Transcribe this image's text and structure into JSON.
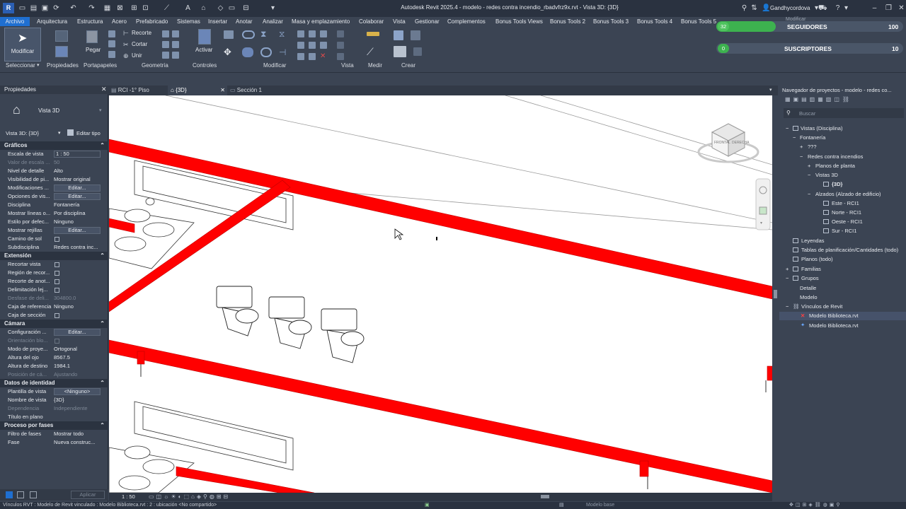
{
  "titlebar": {
    "title": "Autodesk Revit 2025.4 - modelo - redes contra incendio_rbadvfrz9x.rvt - Vista 3D: {3D}",
    "user": "Gandhycordova",
    "app_logo": "R"
  },
  "menu": {
    "items": [
      "Archivo",
      "Arquitectura",
      "Estructura",
      "Acero",
      "Prefabricado",
      "Sistemas",
      "Insertar",
      "Anotar",
      "Analizar",
      "Masa y emplazamiento",
      "Colaborar",
      "Vista",
      "Gestionar",
      "Complementos",
      "Bonus Tools Views",
      "Bonus Tools 2",
      "Bonus Tools 3",
      "Bonus Tools 4",
      "Bonus Tools 5"
    ],
    "extra": "Modificar"
  },
  "ribbon": {
    "modificar_label": "Modificar",
    "pegar_label": "Pegar",
    "recorte_label": "Recorte",
    "cortar_label": "Cortar",
    "unir_label": "Unir",
    "activar_label": "Activar",
    "groups": [
      "Seleccionar",
      "Propiedades",
      "Portapapeles",
      "Geometría",
      "Controles",
      "Modificar",
      "Vista",
      "Medir",
      "Crear"
    ]
  },
  "stream": {
    "followers_label": "SEGUIDORES",
    "followers_current": "32",
    "followers_goal": "100",
    "followers_progress": 0.32,
    "subscribers_label": "SUSCRIPTORES",
    "subscribers_current": "0",
    "subscribers_goal": "10",
    "subscribers_progress": 0.0
  },
  "properties": {
    "title": "Propiedades",
    "type_name": "Vista 3D",
    "selector": "Vista 3D: {3D}",
    "edit_type": "Editar tipo",
    "apply": "Aplicar",
    "sections": {
      "graficos": "Gráficos",
      "extension": "Extensión",
      "camara": "Cámara",
      "identidad": "Datos de identidad",
      "fases": "Proceso por fases"
    },
    "rows": {
      "escala": [
        "Escala de vista",
        "1 : 50"
      ],
      "valor_escala": [
        "Valor de escala ...",
        "50"
      ],
      "detalle": [
        "Nivel de detalle",
        "Alto"
      ],
      "visibilidad": [
        "Visibilidad de pi...",
        "Mostrar original"
      ],
      "modificaciones": [
        "Modificaciones ...",
        "Editar..."
      ],
      "opciones": [
        "Opciones de vis...",
        "Editar..."
      ],
      "disciplina": [
        "Disciplina",
        "Fontanería"
      ],
      "mostrar_lineas": [
        "Mostrar líneas o...",
        "Por disciplina"
      ],
      "estilo": [
        "Estilo por defec...",
        "Ninguno"
      ],
      "rejillas": [
        "Mostrar rejillas",
        "Editar..."
      ],
      "camino_sol": [
        "Camino de sol",
        ""
      ],
      "subdisciplina": [
        "Subdisciplina",
        "Redes contra inc..."
      ],
      "recortar": [
        "Recortar vista",
        ""
      ],
      "region": [
        "Región de recor...",
        ""
      ],
      "recorte_anot": [
        "Recorte de anot...",
        ""
      ],
      "delimitacion": [
        "Delimitación lej...",
        ""
      ],
      "desfase": [
        "Desfase de deli...",
        "304800.0"
      ],
      "caja_ref": [
        "Caja de referencia",
        "Ninguno"
      ],
      "caja_seccion": [
        "Caja de sección",
        ""
      ],
      "configuracion": [
        "Configuración ...",
        "Editar..."
      ],
      "orientacion": [
        "Orientación blo...",
        ""
      ],
      "modo": [
        "Modo de proye...",
        "Ortogonal"
      ],
      "altura_ojo": [
        "Altura del ojo",
        "8567.5"
      ],
      "altura_dest": [
        "Altura de destino",
        "1984.1"
      ],
      "posicion": [
        "Posición de cá...",
        "Ajustando"
      ],
      "plantilla": [
        "Plantilla de vista",
        "<Ninguno>"
      ],
      "nombre": [
        "Nombre de vista",
        "{3D}"
      ],
      "dependencia": [
        "Dependencia",
        "Independiente"
      ],
      "titulo_plano": [
        "Título en plano",
        ""
      ],
      "filtro_fases": [
        "Filtro de fases",
        "Mostrar todo"
      ],
      "fase": [
        "Fase",
        "Nueva construc..."
      ]
    }
  },
  "tabs": [
    "RCI -1° Piso",
    "{3D}",
    "Sección 1"
  ],
  "viewport": {
    "scale": "1 : 50",
    "viewcube_face1": "FRONTAL",
    "viewcube_face2": "DERECHA",
    "pipe_color": "#ff0000"
  },
  "browser": {
    "title": "Navegador de proyectos - modelo - redes co...",
    "search_placeholder": "Buscar",
    "nodes": {
      "vistas": "Vistas (Disciplina)",
      "fontaneria": "Fontanería",
      "qqq": "???",
      "redes": "Redes contra incendios",
      "planos_planta": "Planos de planta",
      "vistas3d": "Vistas 3D",
      "v3d": "{3D}",
      "alzados": "Alzados (Alzado de edificio)",
      "este": "Este - RCI1",
      "norte": "Norte - RCI1",
      "oeste": "Oeste - RCI1",
      "sur": "Sur - RCI1",
      "leyendas": "Leyendas",
      "tablas": "Tablas de planificación/Cantidades (todo)",
      "planos": "Planos (todo)",
      "familias": "Familias",
      "grupos": "Grupos",
      "detalle": "Detalle",
      "modelo": "Modelo",
      "vinculos": "Vínculos de Revit",
      "link1": "Modelo Biblioteca.rvt",
      "link2": "Modelo Biblioteca.rvt"
    }
  },
  "statusbar": {
    "text": "Vínculos RVT : Modelo de Revit vinculado : Modelo Biblioteca.rvt : 2 : ubicación <No compartido>",
    "model": "Modelo base"
  }
}
